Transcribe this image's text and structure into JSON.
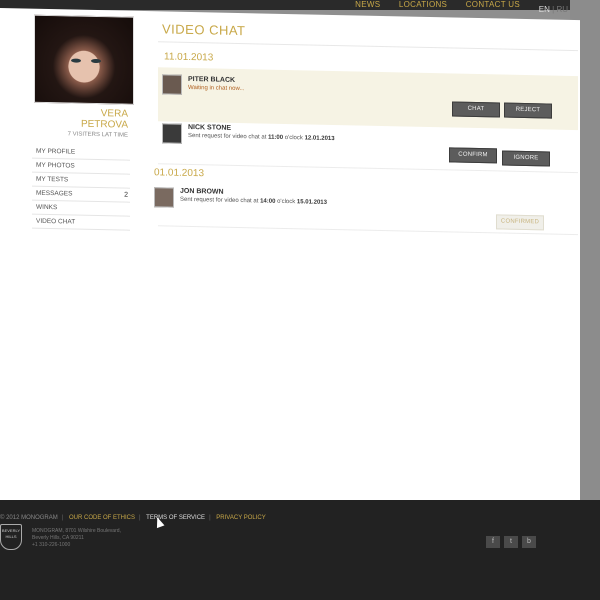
{
  "topnav": {
    "items": [
      "NEWS",
      "LOCATIONS",
      "CONTACT US"
    ]
  },
  "lang": {
    "active": "EN",
    "other": "RU"
  },
  "profile": {
    "first_name": "VERA",
    "last_name": "PETROVA",
    "visitors": "7 VISITERS LAT TIME"
  },
  "menu": [
    {
      "label": "MY PROFILE",
      "badge": ""
    },
    {
      "label": "MY PHOTOS",
      "badge": ""
    },
    {
      "label": "MY TESTS",
      "badge": ""
    },
    {
      "label": "MESSAGES",
      "badge": "2"
    },
    {
      "label": "WINKS",
      "badge": ""
    },
    {
      "label": "VIDEO CHAT",
      "badge": ""
    }
  ],
  "page_title": "VIDEO CHAT",
  "groups": [
    {
      "date": "11.01.2013"
    },
    {
      "date": "01.01.2013"
    }
  ],
  "rows": [
    {
      "name": "PITER BLACK",
      "message": "Waiting in chat now...",
      "btn1": "CHAT",
      "btn2": "REJECT"
    },
    {
      "name": "NICK STONE",
      "msg_pre": "Sent request for video chat at ",
      "time": "11:00",
      "msg_mid": " o'clock ",
      "date": "12.01.2013",
      "btn1": "CONFIRM",
      "btn2": "IGNORE"
    },
    {
      "name": "JON BROWN",
      "msg_pre": "Sent request for video chat at ",
      "time": "14:00",
      "msg_mid": " o'clock ",
      "date": "15.01.2013",
      "btn1": "CONFIRMED"
    }
  ],
  "footer": {
    "copyright": "© 2012 MONOGRAM",
    "links": [
      "OUR CODE OF ETHICS",
      "TERMS OF SERVICE",
      "PRIVACY POLICY"
    ],
    "address": [
      "MONOGRAM, 8701 Wilshire Boulevard,",
      "Beverly Hills, CA 90211",
      "+1 310-226-1000"
    ],
    "seal_text": "BEVERLY HILLS",
    "social": [
      "f",
      "t",
      "b"
    ]
  }
}
